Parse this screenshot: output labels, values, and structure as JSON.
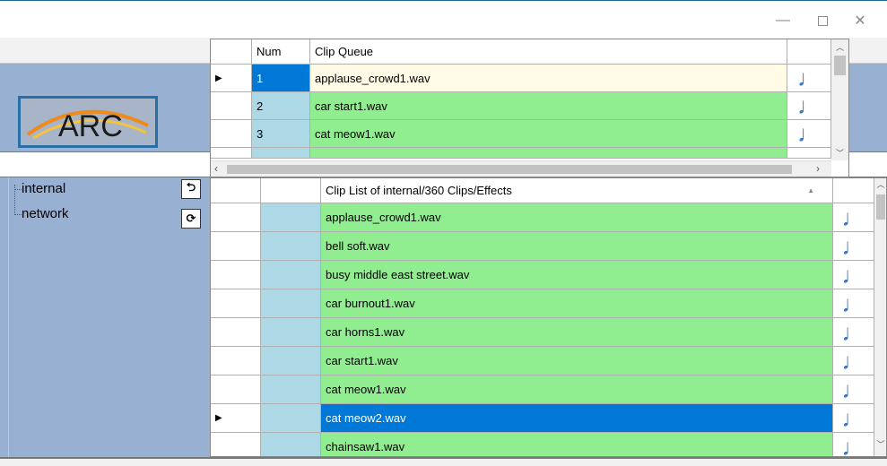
{
  "window": {
    "minimize_glyph": "—",
    "close_glyph": "✕"
  },
  "logo": {
    "text": "ARC"
  },
  "tree": {
    "items": [
      "internal",
      "network"
    ],
    "back_icon": "⮌",
    "refresh_icon": "⟳"
  },
  "queue": {
    "headers": {
      "num": "Num",
      "clip": "Clip Queue"
    },
    "rows": [
      {
        "num": "1",
        "clip": "applause_crowd1.wav",
        "selected": true
      },
      {
        "num": "2",
        "clip": "car start1.wav"
      },
      {
        "num": "3",
        "clip": "cat meow1.wav"
      }
    ],
    "note_icon": "♩"
  },
  "clips": {
    "header": "Clip List of internal/360 Clips/Effects",
    "sort_glyph": "▲",
    "rows": [
      "applause_crowd1.wav",
      "bell soft.wav",
      "busy middle east street.wav",
      "car burnout1.wav",
      "car horns1.wav",
      "car start1.wav",
      "cat meow1.wav",
      "cat meow2.wav",
      "chainsaw1.wav"
    ],
    "selected_index": 7,
    "note_icon": "♩"
  },
  "colors": {
    "panel_blue": "#98b0d2",
    "row_green": "#90ee90",
    "num_blue": "#add8e6",
    "selection": "#0078d7",
    "queue_selected_row": "#fffbe6"
  }
}
